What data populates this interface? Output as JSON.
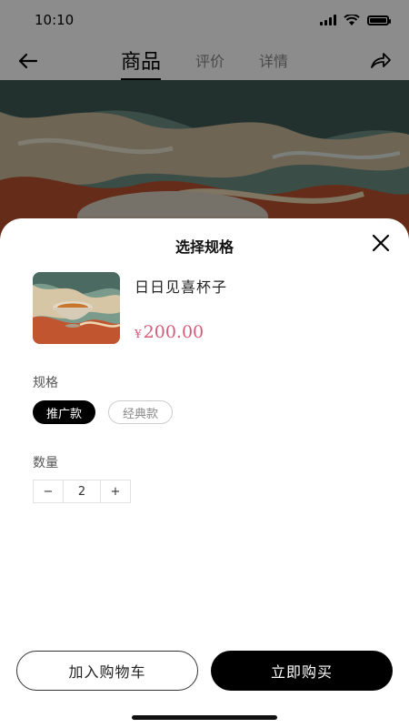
{
  "status_bar": {
    "time": "10:10"
  },
  "nav": {
    "tabs": [
      {
        "label": "商品",
        "active": true
      },
      {
        "label": "评价",
        "active": false
      },
      {
        "label": "详情",
        "active": false
      }
    ]
  },
  "sheet": {
    "title": "选择规格",
    "product": {
      "name": "日日见喜杯子",
      "currency": "¥",
      "price": "200.00"
    },
    "spec": {
      "label": "规格",
      "options": [
        {
          "label": "推广款",
          "selected": true
        },
        {
          "label": "经典款",
          "selected": false
        }
      ]
    },
    "quantity": {
      "label": "数量",
      "minus": "−",
      "value": "2",
      "plus": "+"
    },
    "actions": {
      "add_to_cart": "加入购物车",
      "buy_now": "立即购买"
    }
  },
  "colors": {
    "price": "#d45b7a",
    "primary": "#000000",
    "overlay": "rgba(0,0,0,0.45)"
  },
  "icons": {
    "back": "arrow-left-icon",
    "share": "share-icon",
    "close": "close-icon"
  }
}
